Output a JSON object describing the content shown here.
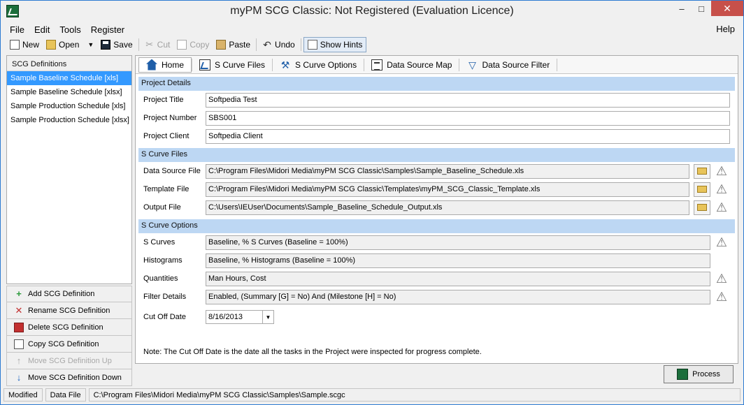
{
  "window": {
    "title": "myPM SCG Classic: Not Registered (Evaluation Licence)",
    "minimize": "–",
    "maximize": "□",
    "close": "✕"
  },
  "menu": {
    "items": [
      "File",
      "Edit",
      "Tools",
      "Register"
    ],
    "help": "Help"
  },
  "toolbar": {
    "new": "New",
    "open": "Open",
    "save": "Save",
    "cut": "Cut",
    "copy": "Copy",
    "paste": "Paste",
    "undo": "Undo",
    "show_hints": "Show Hints"
  },
  "sidebar": {
    "header": "SCG Definitions",
    "items": [
      "Sample Baseline Schedule [xls]",
      "Sample Baseline Schedule [xlsx]",
      "Sample Production Schedule [xls]",
      "Sample Production Schedule [xlsx]"
    ],
    "selected_index": 0,
    "buttons": {
      "add": "Add SCG Definition",
      "rename": "Rename SCG Definition",
      "delete": "Delete SCG Definition",
      "copy": "Copy SCG Definition",
      "move_up": "Move SCG Definition Up",
      "move_down": "Move SCG Definition Down"
    }
  },
  "tabs": {
    "home": "Home",
    "s_curve_files": "S Curve Files",
    "s_curve_options": "S Curve Options",
    "data_source_map": "Data Source Map",
    "data_source_filter": "Data Source Filter"
  },
  "project_details": {
    "section_title": "Project Details",
    "title_label": "Project Title",
    "title_value": "Softpedia Test",
    "number_label": "Project Number",
    "number_value": "SBS001",
    "client_label": "Project Client",
    "client_value": "Softpedia Client"
  },
  "s_curve_files": {
    "section_title": "S Curve Files",
    "data_source_label": "Data Source File",
    "data_source_value": "C:\\Program Files\\Midori Media\\myPM SCG Classic\\Samples\\Sample_Baseline_Schedule.xls",
    "template_label": "Template File",
    "template_value": "C:\\Program Files\\Midori Media\\myPM SCG Classic\\Templates\\myPM_SCG_Classic_Template.xls",
    "output_label": "Output File",
    "output_value": "C:\\Users\\IEUser\\Documents\\Sample_Baseline_Schedule_Output.xls"
  },
  "s_curve_options": {
    "section_title": "S Curve Options",
    "s_curves_label": "S Curves",
    "s_curves_value": "Baseline, % S Curves (Baseline = 100%)",
    "histograms_label": "Histograms",
    "histograms_value": "Baseline, % Histograms (Baseline = 100%)",
    "quantities_label": "Quantities",
    "quantities_value": "Man Hours, Cost",
    "filter_label": "Filter Details",
    "filter_value": "Enabled, (Summary [G] = No) And (Milestone [H] = No)",
    "cutoff_label": "Cut Off Date",
    "cutoff_value": "8/16/2013"
  },
  "note": "Note: The Cut Off Date is the date all the tasks in the Project were inspected for progress complete.",
  "process_button": "Process",
  "status": {
    "modified": "Modified",
    "data_file_label": "Data File",
    "data_file_path": "C:\\Program Files\\Midori Media\\myPM SCG Classic\\Samples\\Sample.scgc"
  }
}
